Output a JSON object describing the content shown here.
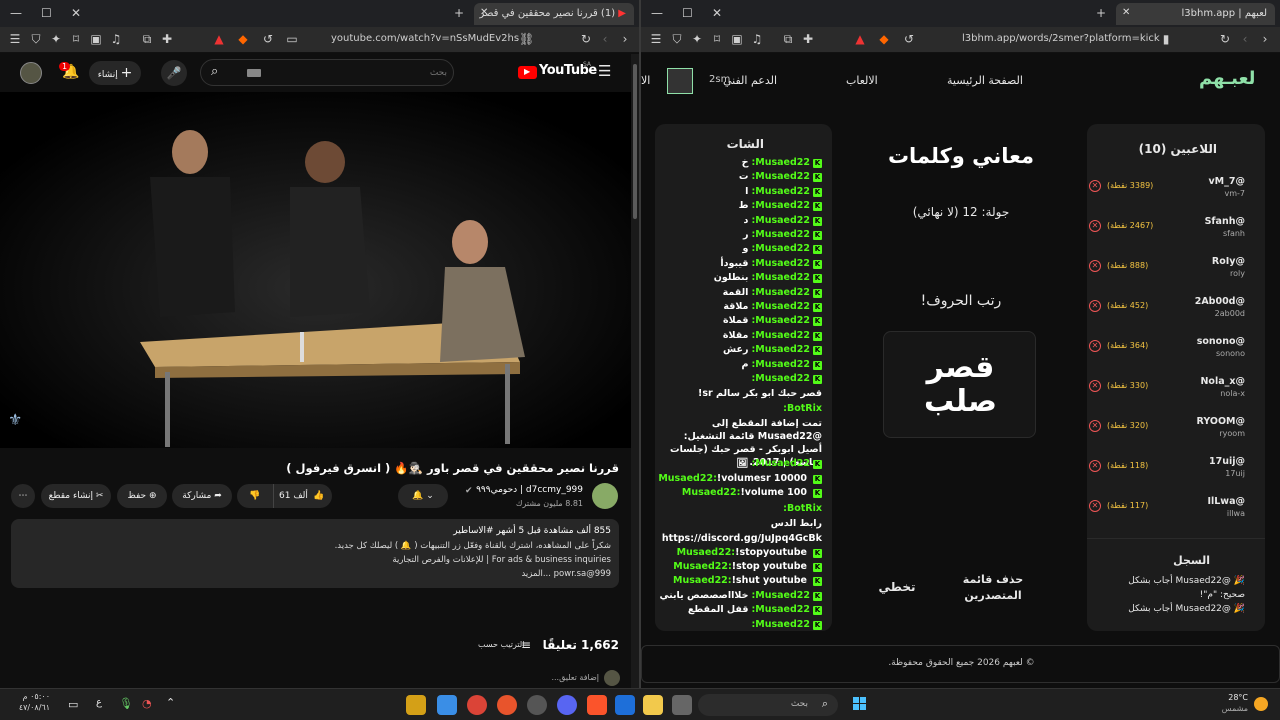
{
  "left_window": {
    "tab_title": "(1) قررنا نصير محققين في قصر",
    "url": "youtube.com/watch?v=nSsMudEv2hs"
  },
  "youtube": {
    "search_placeholder": "بحث",
    "create_label": "إنشاء",
    "notif_count": "1",
    "logo_text": "YouTube",
    "logo_region": "SA",
    "video_title": "قررنا نصير محققين في قصر باور 🕵🏻‍♂️🔥 ( انسرق فيرفول )",
    "channel_name": "d7ccmy_999 | دحومي٩٩٩",
    "subscribers": "8.81 مليون مشترك",
    "like_count": "61 ألف",
    "share_label": "مشاركة",
    "save_label": "حفظ",
    "clip_label": "إنشاء مقطع",
    "desc_stats": "855 ألف مشاهدة قبل 5 أشهر  #الاساطير",
    "desc_line1": "شكراً على المشاهده، اشترك بالقناة وفعّل زر التنبيهات ( 🔔 ) ليصلك كل جديد.",
    "desc_line2": "For ads & business inquiries | للإعلانات والفرص التجارية",
    "desc_line3": "999@powr.sa ...المزيد",
    "comments_count": "1,662 تعليقًا",
    "sort_label": "الترتيب حسب",
    "add_comment": "إضافة تعليق..."
  },
  "right_window": {
    "tab_title": "لعبهم | l3bhm.app",
    "url": "l3bhm.app/words/2smer?platform=kick"
  },
  "app": {
    "logo": "لعبـهم",
    "nav": [
      "الصفحة الرئيسية",
      "الالعاب",
      "الدعم الفني"
    ],
    "nav_user": "2sm",
    "nav_cut": "الا",
    "players_title": "اللاعبين (10)",
    "players": [
      {
        "name": "@vM_7",
        "handle": "vm-7",
        "points": "(3389 نقطة)"
      },
      {
        "name": "@Sfanh",
        "handle": "sfanh",
        "points": "(2467 نقطة)"
      },
      {
        "name": "@RoIy",
        "handle": "roly",
        "points": "(888 نقطة)"
      },
      {
        "name": "@2Ab00d",
        "handle": "2ab00d",
        "points": "(452 نقطة)"
      },
      {
        "name": "@sonono",
        "handle": "sonono",
        "points": "(364 نقطة)"
      },
      {
        "name": "@Nola_x",
        "handle": "nola-x",
        "points": "(330 نقطة)"
      },
      {
        "name": "@RYOOM",
        "handle": "ryoom",
        "points": "(320 نقطة)"
      },
      {
        "name": "@17uij",
        "handle": "17uij",
        "points": "(118 نقطة)"
      },
      {
        "name": "@IlLwa",
        "handle": "illwa",
        "points": "(117 نقطة)"
      }
    ],
    "log_title": "السجل",
    "log": [
      "🎉 @Musaed22 أجاب بشكل",
      "صحيح: \"م\"!",
      "🎉 @Musaed22 أجاب بشكل"
    ],
    "game_title": "معاني وكلمات",
    "round": "جولة: 12 (لا نهائي)",
    "instruction": "رتب الحروف!",
    "word_line1": "قصر",
    "word_line2": "صلب",
    "skip_label": "تخطي",
    "clear_board": "حذف قائمة المتصدرين",
    "chat_title": "الشات",
    "footer": "© لعبهم 2026 جميع الحقوق محفوظة.",
    "chat": [
      {
        "user": "Musaed22:",
        "msg": "خ"
      },
      {
        "user": "Musaed22:",
        "msg": "ت"
      },
      {
        "user": "Musaed22:",
        "msg": "ا"
      },
      {
        "user": "Musaed22:",
        "msg": "ط"
      },
      {
        "user": "Musaed22:",
        "msg": "د"
      },
      {
        "user": "Musaed22:",
        "msg": "ر"
      },
      {
        "user": "Musaed22:",
        "msg": "و"
      },
      {
        "user": "Musaed22:",
        "msg": "قيبودأ"
      },
      {
        "user": "Musaed22:",
        "msg": "بنطلون"
      },
      {
        "user": "Musaed22:",
        "msg": "القمة"
      },
      {
        "user": "Musaed22:",
        "msg": "ملاقة"
      },
      {
        "user": "Musaed22:",
        "msg": "قملاة"
      },
      {
        "user": "Musaed22:",
        "msg": "مقلاة"
      },
      {
        "user": "Musaed22:",
        "msg": "رعش"
      },
      {
        "user": "Musaed22:",
        "msg": "م"
      },
      {
        "user": "Musaed22:",
        "msg": ""
      }
    ],
    "chat_extra1": "قصر حبك ابو بكر سالم sr!",
    "botrix": "BotRix:",
    "bot_msg": "تمت إضافة المقطع إلى @Musaed22 قائمة التشغيل: أصيل ابوبكر - قصر حبك (جلسات وناسه) | 2017.",
    "chat2": [
      {
        "user": "Musaed22:",
        "msg": "🖼"
      },
      {
        "user": "Musaed22:",
        "msg": "!volumesr 10000"
      },
      {
        "user": "Musaed22:",
        "msg": "!volume 100"
      }
    ],
    "bot_msg2_a": "رابط الدس",
    "bot_msg2_b": "https://discord.gg/JuJpq4GcBk",
    "chat3": [
      {
        "user": "Musaed22:",
        "msg": "!stopyoutube"
      },
      {
        "user": "Musaed22:",
        "msg": "!stop youtube"
      },
      {
        "user": "Musaed22:",
        "msg": "!shut youtube"
      },
      {
        "user": "Musaed22:",
        "msg": "خلاااصصصص يابني"
      },
      {
        "user": "Musaed22:",
        "msg": "قفل المقطع"
      },
      {
        "user": "Musaed22:",
        "msg": ""
      }
    ]
  },
  "taskbar": {
    "time": "٠٥:٠٠ م",
    "date": "٤٧/٠٨/٦١",
    "lang": "ع",
    "search": "بحث",
    "temp": "28°C",
    "weather": "مشمس"
  }
}
